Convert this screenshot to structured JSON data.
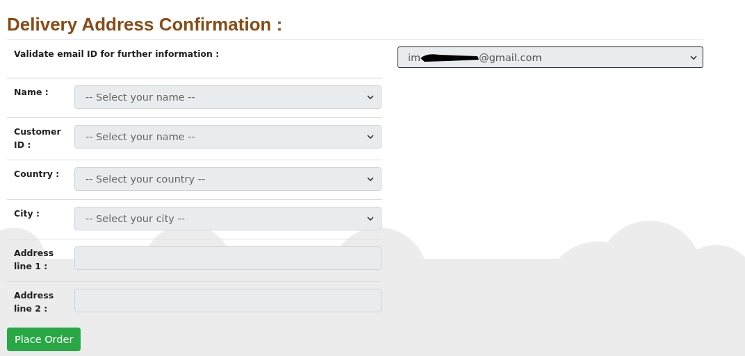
{
  "title": "Delivery Address Confirmation :",
  "email": {
    "label": "Validate email ID for further information :",
    "value_start": "im",
    "value_end": "@gmail.com",
    "redacted": true
  },
  "fields": [
    {
      "kind": "select",
      "label": "Name :",
      "placeholder": "-- Select your name --"
    },
    {
      "kind": "select",
      "label": "Customer ID :",
      "placeholder": "-- Select your name --"
    },
    {
      "kind": "select",
      "label": "Country :",
      "placeholder": "-- Select your country --"
    },
    {
      "kind": "select",
      "label": "City :",
      "placeholder": "-- Select your city --"
    },
    {
      "kind": "text",
      "label": "Address line 1 :"
    },
    {
      "kind": "text",
      "label": "Address line 2 :"
    }
  ],
  "button": "Place Order"
}
